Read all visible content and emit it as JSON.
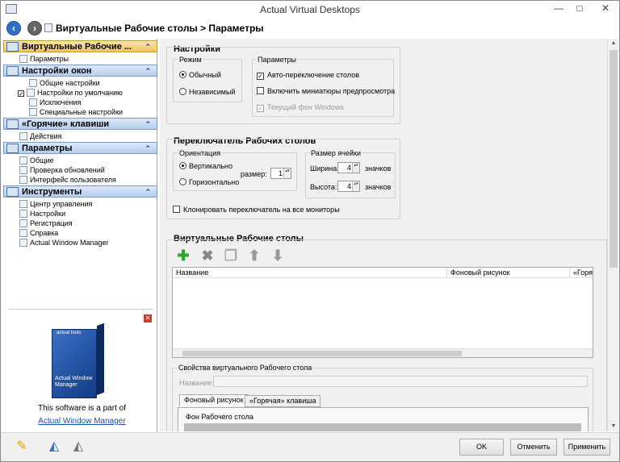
{
  "window": {
    "title": "Actual Virtual Desktops",
    "minimize": "—",
    "maximize": "□",
    "close": "✕"
  },
  "nav": {
    "back_icon": "arrow-left",
    "forward_icon": "arrow-right",
    "breadcrumb": "Виртуальные Рабочие столы > Параметры"
  },
  "sidebar": {
    "sections": [
      {
        "title": "Виртуальные Рабочие ...",
        "caret": "⌃",
        "items": [
          "Параметры"
        ]
      },
      {
        "title": "Настройки окон",
        "caret": "⌃",
        "items": [
          "Общие настройки",
          "Настройки по умолчанию",
          "Исключения",
          "Специальные настройки"
        ]
      },
      {
        "title": "«Горячие» клавиши",
        "caret": "⌃",
        "items": [
          "Действия"
        ]
      },
      {
        "title": "Параметры",
        "caret": "⌃",
        "items": [
          "Общие",
          "Проверка обновлений",
          "Интерфейс пользователя"
        ]
      },
      {
        "title": "Инструменты",
        "caret": "⌃",
        "items": [
          "Центр управления",
          "Настройки",
          "Регистрация",
          "Справка",
          "Actual Window Manager"
        ]
      }
    ],
    "checked_mark": "✓",
    "promo": {
      "close": "✕",
      "box_logo": "actual tools",
      "box_label": "Actual Window Manager",
      "text": "This software is a part of",
      "link": "Actual Window Manager"
    }
  },
  "settings": {
    "heading": "Настройки",
    "mode_group": "Режим",
    "mode_normal": "Обычный",
    "mode_independent": "Независимый",
    "params_group": "Параметры",
    "auto_switch": "Авто-переключение столов",
    "auto_switch_mark": "✓",
    "thumbnails": "Включить миниатюры предпросмотра",
    "current_bg": "Текущий фон Windows",
    "current_bg_mark": "✓"
  },
  "switcher": {
    "heading": "Переключатель Рабочих столов",
    "orientation_group": "Ориентация",
    "vertical": "Вертикально",
    "horizontal": "Горизонтально",
    "size_label": "размер:",
    "size_value": "1",
    "cell_group": "Размер ячейки",
    "width_label": "Ширина:",
    "width_value": "4",
    "height_label": "Высота:",
    "height_value": "4",
    "units": "значков",
    "clone": "Клонировать переключатель на все мониторы"
  },
  "desktops": {
    "heading": "Виртуальные Рабочие столы",
    "toolbar": {
      "add": "✚",
      "delete": "✖",
      "copy": "❐",
      "up": "⬆",
      "down": "⬇"
    },
    "columns": [
      "Название",
      "Фоновый рисунок",
      "«Горяч"
    ],
    "props_group": "Свойства виртуального Рабочего стола",
    "name_label": "Название:",
    "tabs": [
      "Фоновый рисунок",
      "«Горячая» клавиша"
    ],
    "bg_group": "Фон Рабочего стола"
  },
  "footer": {
    "ok": "OK",
    "cancel": "Отменить",
    "apply": "Применить"
  },
  "colors": {
    "accent": "#2e6fc8",
    "active_section": "#f0c360",
    "section": "#b6cdee",
    "add_icon": "#2fa52a"
  }
}
